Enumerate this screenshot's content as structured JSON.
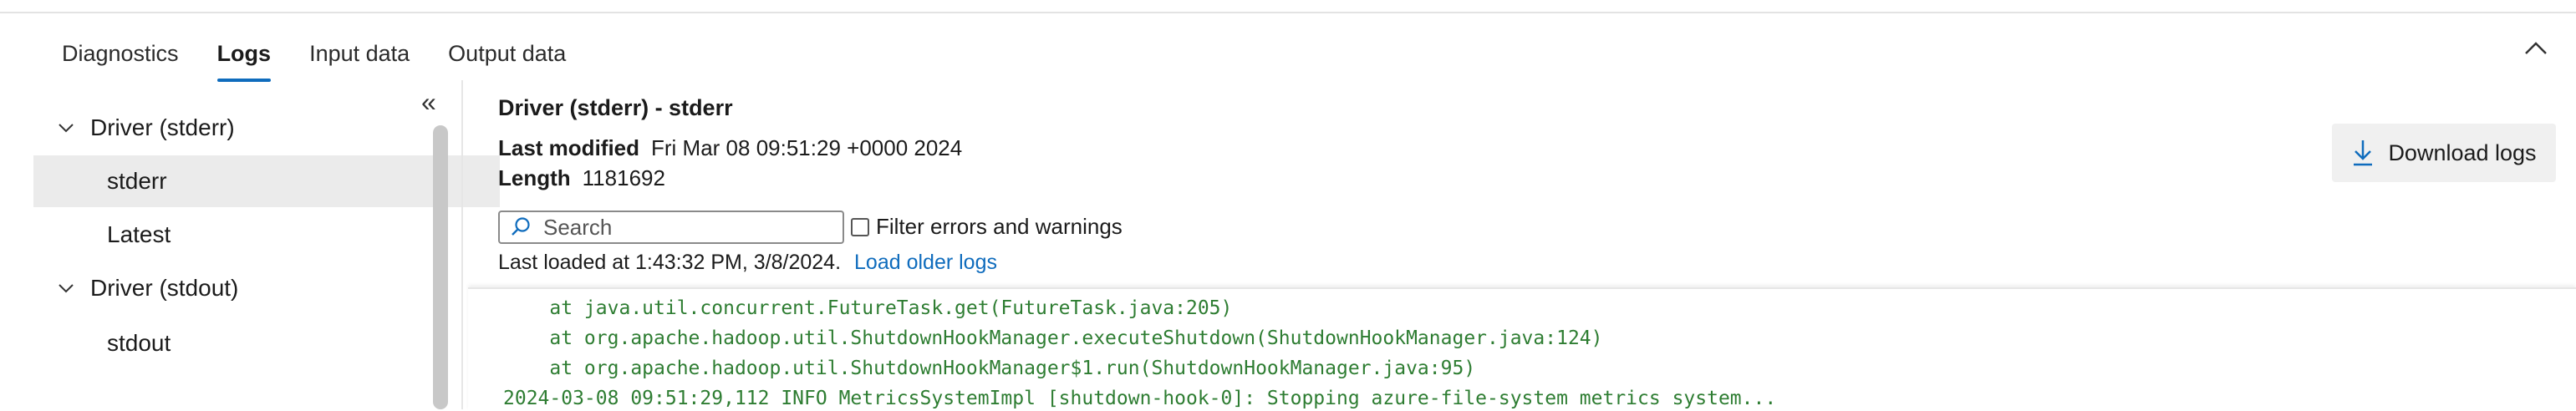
{
  "tabs": [
    {
      "label": "Diagnostics",
      "active": false
    },
    {
      "label": "Logs",
      "active": true
    },
    {
      "label": "Input data",
      "active": false
    },
    {
      "label": "Output data",
      "active": false
    }
  ],
  "sidebar": {
    "collapse_glyph": "«",
    "items": [
      {
        "label": "Driver (stderr)",
        "type": "group",
        "expanded": true
      },
      {
        "label": "stderr",
        "type": "child",
        "selected": true
      },
      {
        "label": "Latest",
        "type": "child",
        "selected": false
      },
      {
        "label": "Driver (stdout)",
        "type": "group",
        "expanded": true
      },
      {
        "label": "stdout",
        "type": "child",
        "selected": false
      }
    ]
  },
  "detail": {
    "title": "Driver (stderr) - stderr",
    "last_modified_label": "Last modified",
    "last_modified_value": "Fri Mar 08 09:51:29 +0000 2024",
    "length_label": "Length",
    "length_value": "1181692",
    "search_placeholder": "Search",
    "filter_label": "Filter errors and warnings",
    "filter_checked": false,
    "last_loaded": "Last loaded at 1:43:32 PM, 3/8/2024.",
    "load_older": "Load older logs",
    "download_label": "Download logs"
  },
  "log_lines": [
    "    at java.util.concurrent.FutureTask.get(FutureTask.java:205)",
    "    at org.apache.hadoop.util.ShutdownHookManager.executeShutdown(ShutdownHookManager.java:124)",
    "    at org.apache.hadoop.util.ShutdownHookManager$1.run(ShutdownHookManager.java:95)",
    "2024-03-08 09:51:29,112 INFO MetricsSystemImpl [shutdown-hook-0]: Stopping azure-file-system metrics system..."
  ],
  "colors": {
    "accent": "#0f6cbd",
    "log_text": "#2e7d32",
    "selected_bg": "#ebebeb"
  }
}
